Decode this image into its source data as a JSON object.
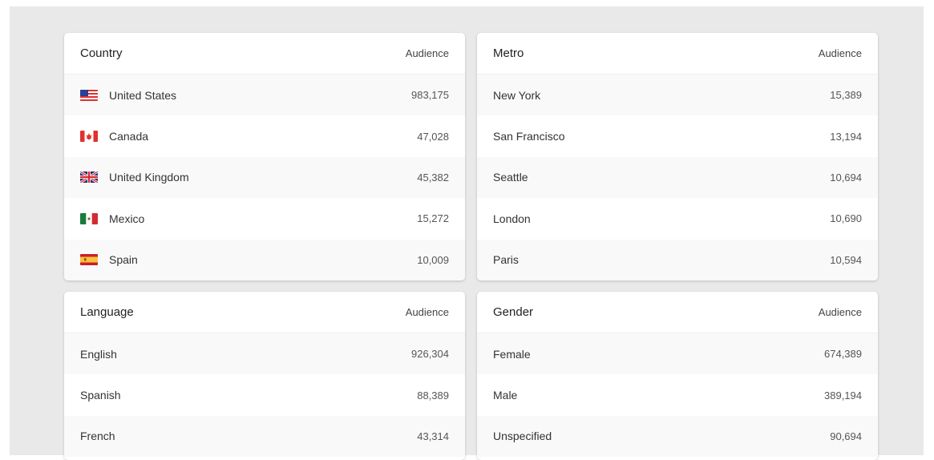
{
  "country": {
    "title": "Country",
    "column": "Audience",
    "rows": [
      {
        "label": "United States",
        "value": "983,175",
        "flag": "us-flag-icon"
      },
      {
        "label": "Canada",
        "value": "47,028",
        "flag": "canada-flag-icon"
      },
      {
        "label": "United Kingdom",
        "value": "45,382",
        "flag": "uk-flag-icon"
      },
      {
        "label": "Mexico",
        "value": "15,272",
        "flag": "mexico-flag-icon"
      },
      {
        "label": "Spain",
        "value": "10,009",
        "flag": "spain-flag-icon"
      }
    ]
  },
  "metro": {
    "title": "Metro",
    "column": "Audience",
    "rows": [
      {
        "label": "New York",
        "value": "15,389"
      },
      {
        "label": "San Francisco",
        "value": "13,194"
      },
      {
        "label": "Seattle",
        "value": "10,694"
      },
      {
        "label": "London",
        "value": "10,690"
      },
      {
        "label": "Paris",
        "value": "10,594"
      }
    ]
  },
  "language": {
    "title": "Language",
    "column": "Audience",
    "rows": [
      {
        "label": "English",
        "value": "926,304"
      },
      {
        "label": "Spanish",
        "value": "88,389"
      },
      {
        "label": "French",
        "value": "43,314"
      }
    ]
  },
  "gender": {
    "title": "Gender",
    "column": "Audience",
    "rows": [
      {
        "label": "Female",
        "value": "674,389"
      },
      {
        "label": "Male",
        "value": "389,194"
      },
      {
        "label": "Unspecified",
        "value": "90,694"
      }
    ]
  }
}
